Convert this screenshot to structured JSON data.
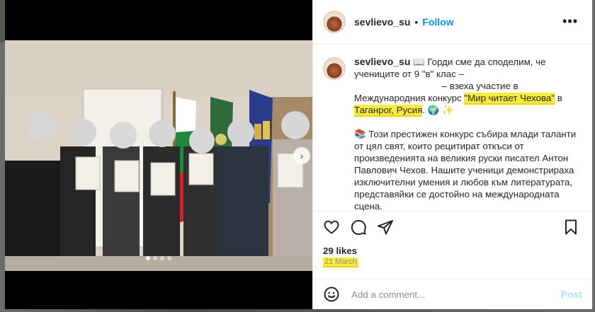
{
  "post": {
    "username": "sevlievo_su",
    "separator": "•",
    "follow_label": "Follow",
    "more_label": "•••"
  },
  "caption": {
    "username": "sevlievo_su",
    "book_emoji": "📖",
    "line1": "Горди сме да споделим, че учениците от 9 \"в\" клас –",
    "line2": "– взеха участие в Международния конкурс",
    "contest_name": "\"Мир читает Чехова\"",
    "in_word": "в",
    "location": "Таганрог, Русия",
    "line_end": ". 🌍 ✨",
    "paragraph2": "📚 Този престижен конкурс събира млади таланти от цял свят, които рецитират откъси от произведенията на великия руски писател Антон Павлович Чехов. Нашите ученици демонстрираха изключителни умения и любов към литературата, представяйки се достойно на международната сцена."
  },
  "actions": {
    "like_icon": "heart-icon",
    "comment_icon": "comment-icon",
    "share_icon": "share-icon",
    "save_icon": "bookmark-icon"
  },
  "likes": "29 likes",
  "date": "21 March",
  "comment_box": {
    "placeholder": "Add a comment...",
    "post_label": "Post",
    "emoji_icon": "smiley-icon"
  },
  "colors": {
    "accent": "#0095f6",
    "highlight": "#f7ec38",
    "post_disabled": "#b2dffc"
  }
}
